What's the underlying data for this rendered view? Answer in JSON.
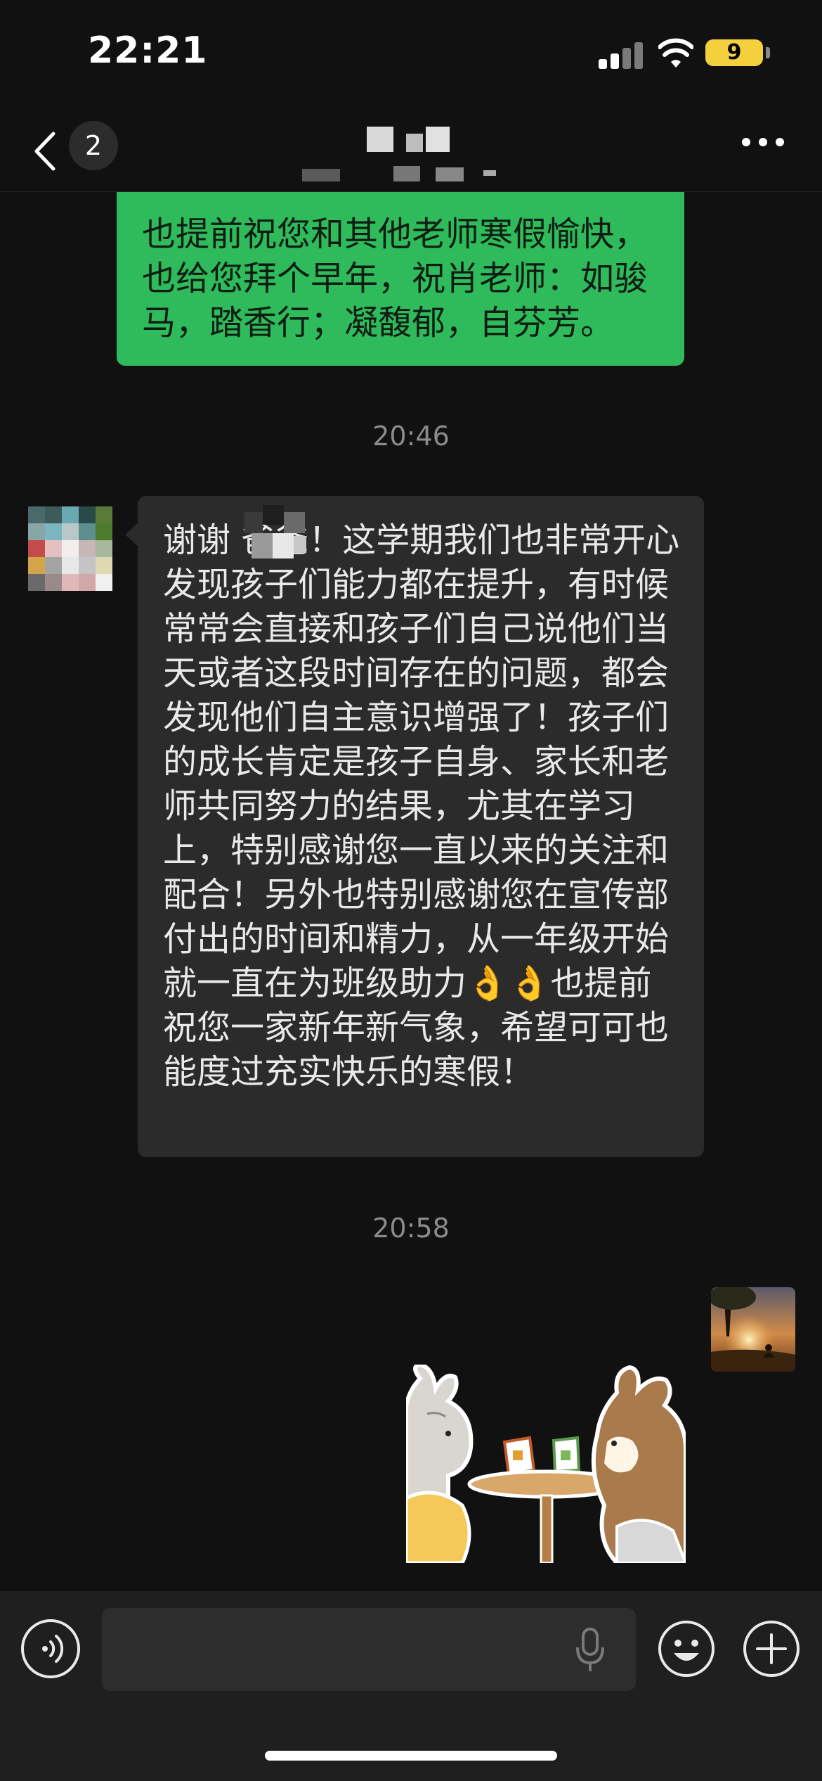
{
  "status_bar": {
    "time": "22:21",
    "battery": "9"
  },
  "nav": {
    "unread_count": "2"
  },
  "messages": [
    {
      "type": "text",
      "sender": "me",
      "text": "也提前祝您和其他老师寒假愉快，也给您拜个早年，祝肖老师：如骏马，踏香行；凝馥郁，自芬芳。"
    },
    {
      "type": "time",
      "text": "20:46"
    },
    {
      "type": "text",
      "sender": "other",
      "text": "谢谢                爸爸！这学期我们也非常开心发现孩子们能力都在提升，有时候常常会直接和孩子们自己说他们当天或者这段时间存在的问题，都会发现他们自主意识增强了！孩子们的成长肯定是孩子自身、家长和老师共同努力的结果，尤其在学习上，特别感谢您一直以来的关注和配合！另外也特别感谢您在宣传部付出的时间和精力，从一年级开始就一直在为班级助力👌👌也提前祝您一家新年新气象，希望可可也能度过充实快乐的寒假！"
    },
    {
      "type": "time",
      "text": "20:58"
    },
    {
      "type": "sticker",
      "sender": "me"
    }
  ],
  "icons": {
    "back": "chevron-left-icon",
    "more": "more-dots-icon",
    "voice": "voice-input-icon",
    "mic": "microphone-icon",
    "emoji": "emoji-icon",
    "plus": "plus-icon"
  },
  "colors": {
    "bubble_me": "#2fbb5b",
    "bubble_other": "#2b2b2b",
    "background": "#111111",
    "battery": "#f4d03f"
  }
}
